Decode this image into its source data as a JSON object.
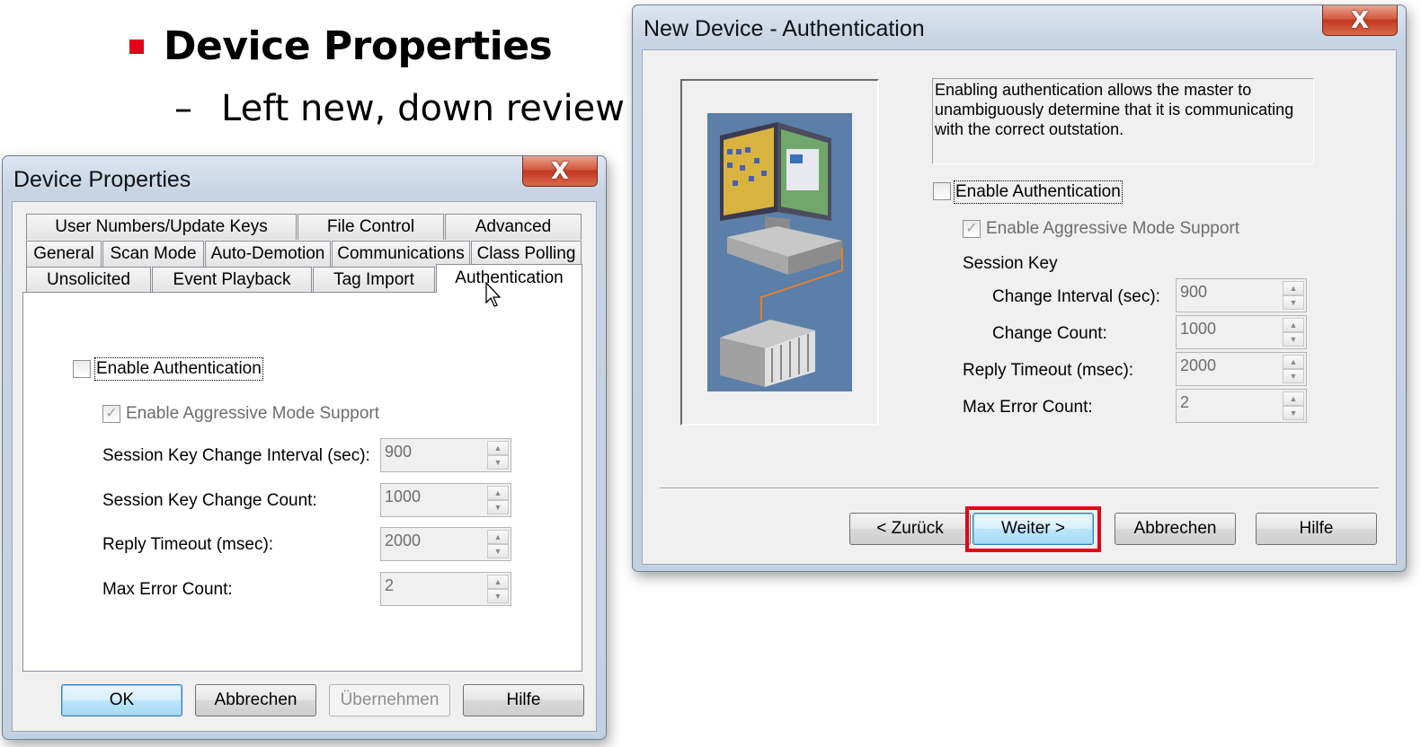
{
  "slide": {
    "title": "Device Properties",
    "subtitle": "Left new, down review",
    "dash": "–"
  },
  "device_properties": {
    "title": "Device Properties",
    "close_glyph": "X",
    "tabs_row1": [
      "User Numbers/Update Keys",
      "File Control",
      "Advanced"
    ],
    "tabs_row2": [
      "General",
      "Scan Mode",
      "Auto-Demotion",
      "Communications",
      "Class Polling"
    ],
    "tabs_row3": [
      "Unsolicited",
      "Event Playback",
      "Tag Import",
      "Authentication"
    ],
    "enable_auth": "Enable Authentication",
    "aggressive_mode": "Enable Aggressive Mode Support",
    "check_glyph": "✓",
    "fields": [
      {
        "label": "Session Key Change Interval (sec):",
        "value": "900"
      },
      {
        "label": "Session Key Change Count:",
        "value": "1000"
      },
      {
        "label": "Reply Timeout (msec):",
        "value": "2000"
      },
      {
        "label": "Max Error Count:",
        "value": "2"
      }
    ],
    "buttons": {
      "ok": "OK",
      "cancel": "Abbrechen",
      "apply": "Übernehmen",
      "help": "Hilfe"
    }
  },
  "new_device": {
    "title": "New Device - Authentication",
    "close_glyph": "X",
    "description": "Enabling authentication allows the master to unambiguously determine that it is communicating with the correct outstation.",
    "enable_auth": "Enable Authentication",
    "aggressive_mode": "Enable Aggressive Mode Support",
    "check_glyph": "✓",
    "session_key": "Session Key",
    "fields": [
      {
        "label": "Change Interval (sec):",
        "value": "900"
      },
      {
        "label": "Change Count:",
        "value": "1000"
      },
      {
        "label": "Reply Timeout (msec):",
        "value": "2000"
      },
      {
        "label": "Max Error Count:",
        "value": "2"
      }
    ],
    "buttons": {
      "back": "< Zurück",
      "next": "Weiter >",
      "cancel": "Abbrechen",
      "help": "Hilfe"
    }
  },
  "icons": {
    "spin_up": "▲",
    "spin_down": "▼"
  },
  "colors": {
    "accent_red": "#e2001a",
    "illustration_bg": "#5b7fa8"
  }
}
